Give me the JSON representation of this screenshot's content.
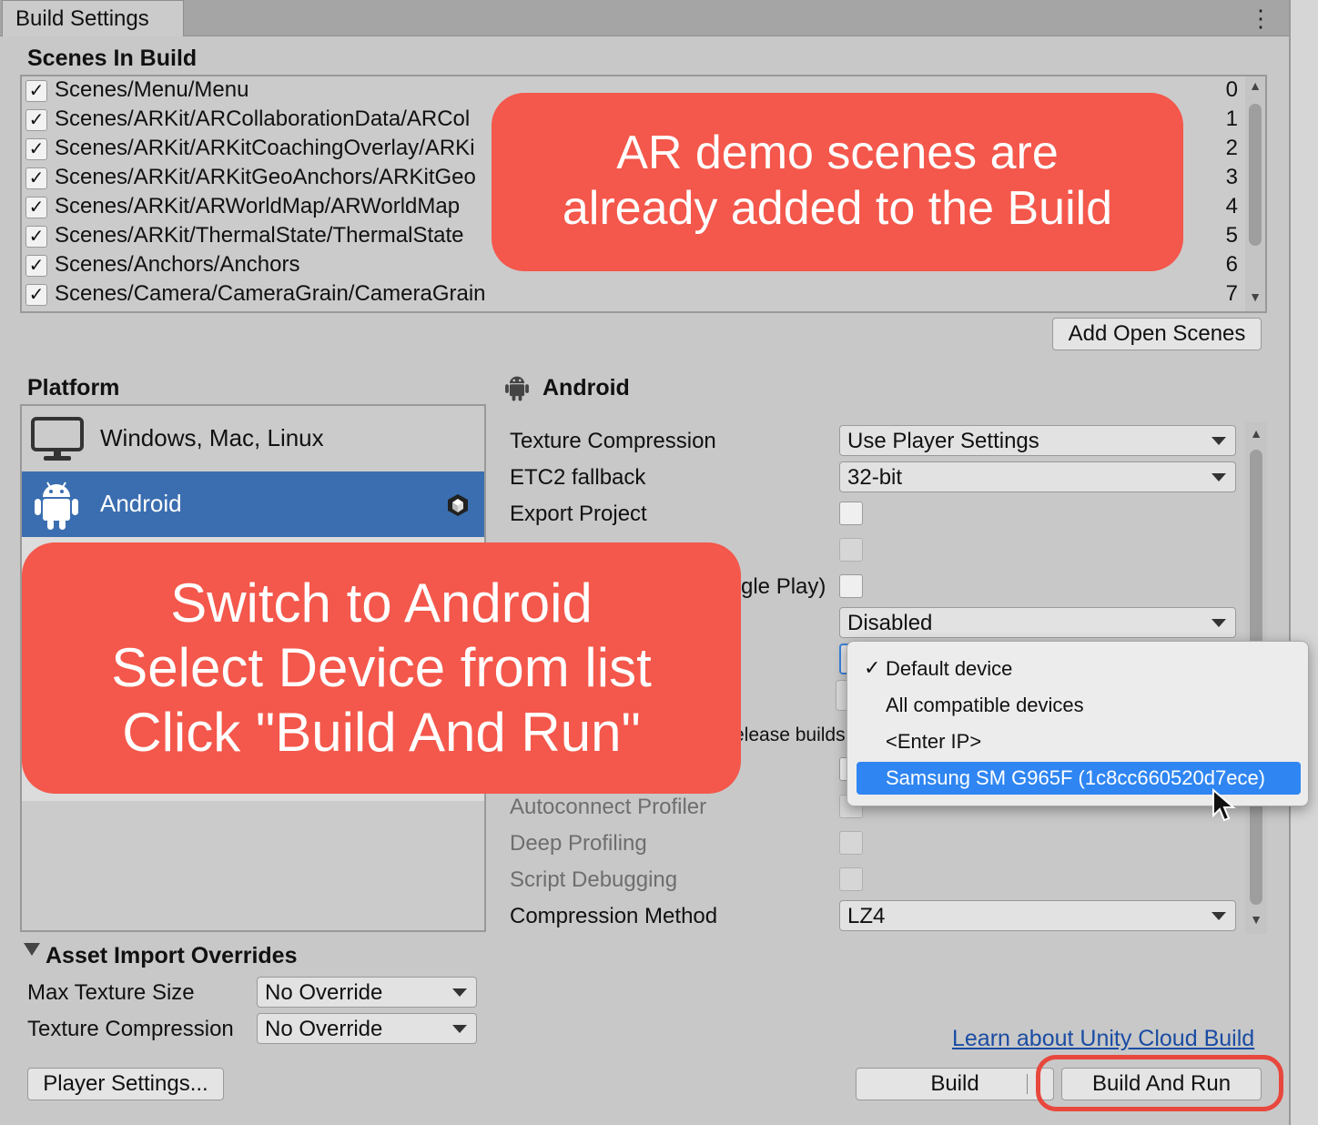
{
  "window": {
    "tab_title": "Build Settings",
    "menu_icon": "kebab-menu-icon"
  },
  "scenes": {
    "header": "Scenes In Build",
    "items": [
      {
        "name": "Scenes/Menu/Menu",
        "index": "0",
        "checked": true
      },
      {
        "name": "Scenes/ARKit/ARCollaborationData/ARCol",
        "index": "1",
        "checked": true
      },
      {
        "name": "Scenes/ARKit/ARKitCoachingOverlay/ARKi",
        "index": "2",
        "checked": true
      },
      {
        "name": "Scenes/ARKit/ARKitGeoAnchors/ARKitGeo",
        "index": "3",
        "checked": true
      },
      {
        "name": "Scenes/ARKit/ARWorldMap/ARWorldMap",
        "index": "4",
        "checked": true
      },
      {
        "name": "Scenes/ARKit/ThermalState/ThermalState",
        "index": "5",
        "checked": true
      },
      {
        "name": "Scenes/Anchors/Anchors",
        "index": "6",
        "checked": true
      },
      {
        "name": "Scenes/Camera/CameraGrain/CameraGrain",
        "index": "7",
        "checked": true
      }
    ],
    "add_open_scenes": "Add Open Scenes"
  },
  "platform": {
    "header": "Platform",
    "items": [
      {
        "label": "Windows, Mac, Linux",
        "icon": "monitor-icon",
        "selected": false
      },
      {
        "label": "Android",
        "icon": "android-icon",
        "selected": true
      }
    ]
  },
  "settings": {
    "header": "Android",
    "fields": {
      "texture_compression": {
        "label": "Texture Compression",
        "value": "Use Player Settings"
      },
      "etc2_fallback": {
        "label": "ETC2 fallback",
        "value": "32-bit"
      },
      "export_project": {
        "label": "Export Project"
      },
      "google_play_partial": {
        "label": "gle Play)"
      },
      "disabled_value": "Disabled",
      "release_builds_partial": "elease builds",
      "autoconnect_profiler": {
        "label": "Autoconnect Profiler"
      },
      "deep_profiling": {
        "label": "Deep Profiling"
      },
      "script_debugging": {
        "label": "Script Debugging"
      },
      "compression_method": {
        "label": "Compression Method",
        "value": "LZ4"
      }
    }
  },
  "device_popup": {
    "items": [
      {
        "label": "Default device",
        "checked": true,
        "selected": false
      },
      {
        "label": "All compatible devices",
        "checked": false,
        "selected": false
      },
      {
        "label": "<Enter IP>",
        "checked": false,
        "selected": false
      },
      {
        "label": "Samsung SM G965F (1c8cc660520d7ece)",
        "checked": false,
        "selected": true
      }
    ]
  },
  "asset_import": {
    "header": "Asset Import Overrides",
    "max_texture_size": {
      "label": "Max Texture Size",
      "value": "No Override"
    },
    "texture_compression": {
      "label": "Texture Compression",
      "value": "No Override"
    }
  },
  "footer": {
    "cloud_link": "Learn about Unity Cloud Build",
    "player_settings": "Player Settings...",
    "build": "Build",
    "build_and_run": "Build And Run"
  },
  "callouts": {
    "scenes_line1": "AR demo scenes are",
    "scenes_line2": "already added to the Build",
    "steps_line1": "Switch to Android",
    "steps_line2": "Select Device from list",
    "steps_line3": "Click \"Build And Run\""
  },
  "colors": {
    "accent": "#3b6eb0",
    "callout": "#f4574b",
    "highlight_ring": "#e8473d",
    "popup_selection": "#2f86f2"
  }
}
